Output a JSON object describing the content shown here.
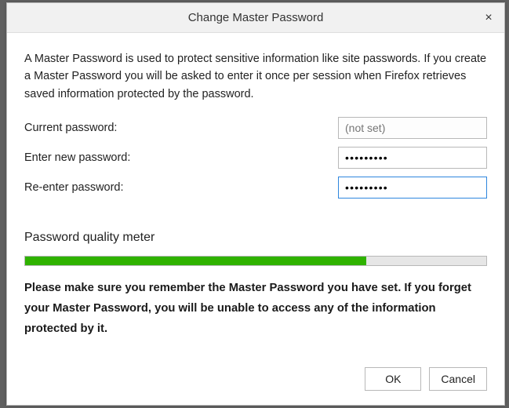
{
  "titlebar": {
    "title": "Change Master Password",
    "close_icon": "×"
  },
  "intro": "A Master Password is used to protect sensitive information like site passwords. If you create a Master Password you will be asked to enter it once per session when Firefox retrieves saved information protected by the password.",
  "form": {
    "current_label": "Current password:",
    "current_placeholder": "(not set)",
    "current_value": "",
    "new_label": "Enter new password:",
    "new_value": "•••••••••",
    "reenter_label": "Re-enter password:",
    "reenter_value": "•••••••••"
  },
  "quality": {
    "label": "Password quality meter",
    "percent": 74
  },
  "warning": "Please make sure you remember the Master Password you have set. If you forget your Master Password, you will be unable to access any of the information protected by it.",
  "buttons": {
    "ok": "OK",
    "cancel": "Cancel"
  }
}
